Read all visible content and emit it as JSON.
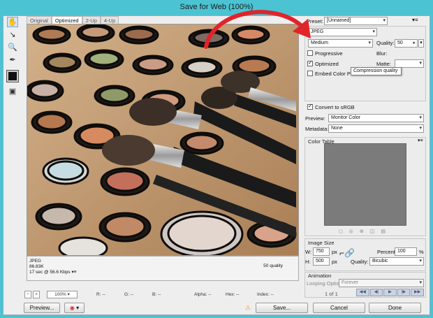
{
  "title": "Save for Web (100%)",
  "tabs": [
    "Original",
    "Optimized",
    "2-Up",
    "4-Up"
  ],
  "info": {
    "format": "JPEG",
    "size": "86.83K",
    "speed": "17 sec @ 56.6 Kbps",
    "quality": "50 quality"
  },
  "status": {
    "zoom": "100%",
    "r": "R: --",
    "g": "G: --",
    "b": "B: --",
    "alpha": "Alpha: --",
    "hex": "Hex: --",
    "index": "Index: --"
  },
  "buttons": {
    "preview": "Preview...",
    "save": "Save...",
    "cancel": "Cancel",
    "done": "Done"
  },
  "settings": {
    "preset_label": "Preset:",
    "preset": "[Unnamed]",
    "format": "JPEG",
    "compression": "Medium",
    "quality_label": "Quality:",
    "quality": "50",
    "progressive": "Progressive",
    "optimized": "Optimized",
    "embed_profile": "Embed Color Profile",
    "matte_label": "Matte:",
    "blur_label": "Blur:",
    "convert_srgb": "Convert to sRGB",
    "preview_label": "Preview:",
    "preview_value": "Monitor Color",
    "metadata_label": "Metadata:",
    "metadata_value": "None"
  },
  "tooltip": "Compression quality",
  "color_table": {
    "title": "Color Table"
  },
  "image_size": {
    "title": "Image Size",
    "w_label": "W:",
    "w": "750",
    "h_label": "H:",
    "h": "500",
    "unit": "px",
    "percent_label": "Percent:",
    "percent": "100",
    "pct": "%",
    "quality_label": "Quality:",
    "quality": "Bicubic"
  },
  "animation": {
    "title": "Animation",
    "looping_label": "Looping Options:",
    "looping": "Forever",
    "frame": "1 of 1"
  },
  "colors": {
    "accent": "#4cc3d2",
    "arrow": "#e0242b",
    "swatch": "#111111"
  }
}
